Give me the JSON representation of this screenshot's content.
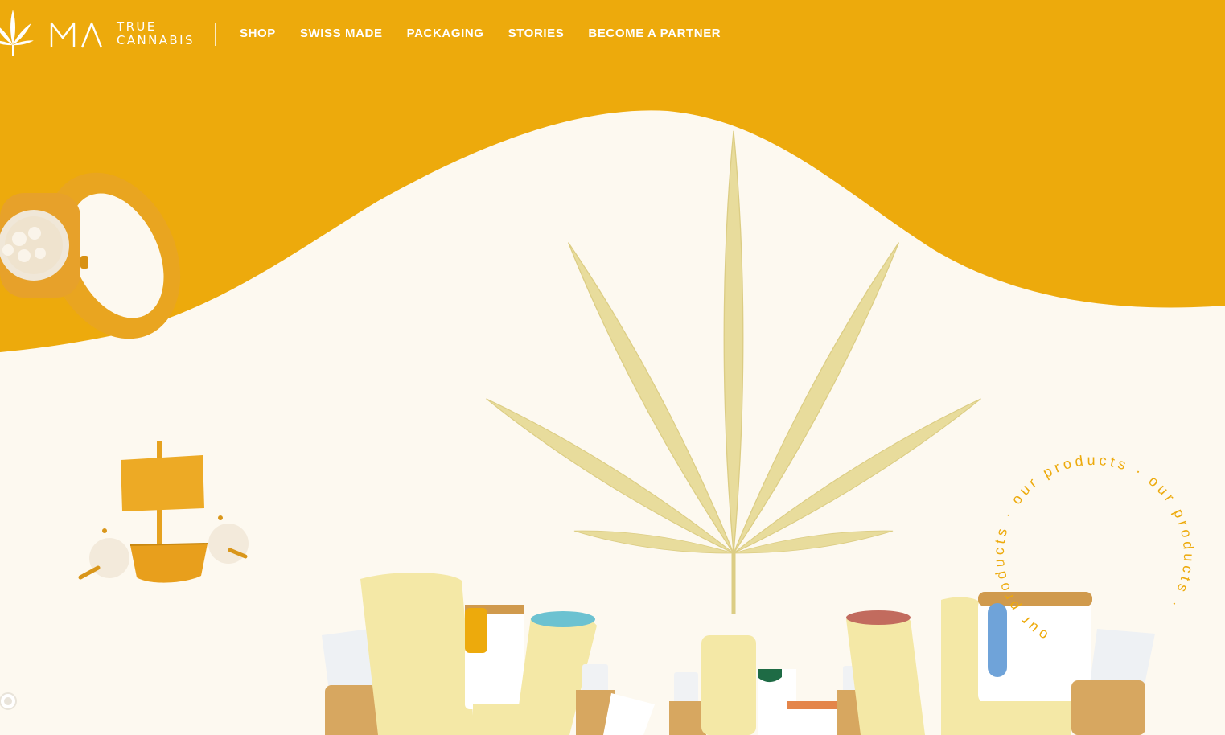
{
  "brand": {
    "logo_mark": "MA",
    "line1": "TRUE",
    "line2": "CANNABIS"
  },
  "nav": {
    "items": [
      {
        "label": "SHOP"
      },
      {
        "label": "SWISS MADE"
      },
      {
        "label": "PACKAGING"
      },
      {
        "label": "STORIES"
      },
      {
        "label": "BECOME A PARTNER"
      }
    ]
  },
  "hero": {
    "rotating_text": "our products · our products · our products · "
  },
  "colors": {
    "brand_yellow": "#EDAA0C",
    "cream": "#FDF9F0",
    "product_pale": "#F3E7A6",
    "leaf": "#E8DC9C"
  },
  "icons": {
    "logo": "cannabis-leaf-icon",
    "chat": "chat-bubble-icon"
  }
}
